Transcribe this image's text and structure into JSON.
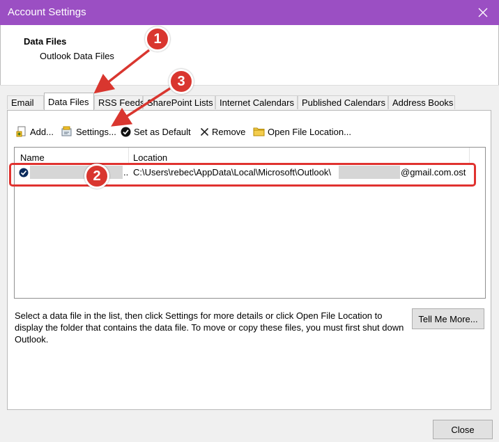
{
  "window": {
    "title": "Account Settings"
  },
  "header": {
    "title": "Data Files",
    "subtitle": "Outlook Data Files"
  },
  "tabs": [
    {
      "label": "Email"
    },
    {
      "label": "Data Files"
    },
    {
      "label": "RSS Feeds"
    },
    {
      "label": "SharePoint Lists"
    },
    {
      "label": "Internet Calendars"
    },
    {
      "label": "Published Calendars"
    },
    {
      "label": "Address Books"
    }
  ],
  "toolbar": {
    "add": "Add...",
    "settings": "Settings...",
    "set_default": "Set as Default",
    "remove": "Remove",
    "open_location": "Open File Location..."
  },
  "list": {
    "columns": [
      "Name",
      "Location"
    ],
    "row": {
      "name_suffix": "..",
      "location_prefix": "C:\\Users\\rebec\\AppData\\Local\\Microsoft\\Outlook\\",
      "location_suffix": "@gmail.com.ost"
    }
  },
  "help_text": "Select a data file in the list, then click Settings for more details or click Open File Location to display the folder that contains the data file. To move or copy these files, you must first shut down Outlook.",
  "buttons": {
    "tell_me_more": "Tell Me More...",
    "close": "Close"
  },
  "annotations": [
    "1",
    "2",
    "3"
  ],
  "colors": {
    "titlebar": "#9b4fc3",
    "annotation": "#d9362f"
  }
}
